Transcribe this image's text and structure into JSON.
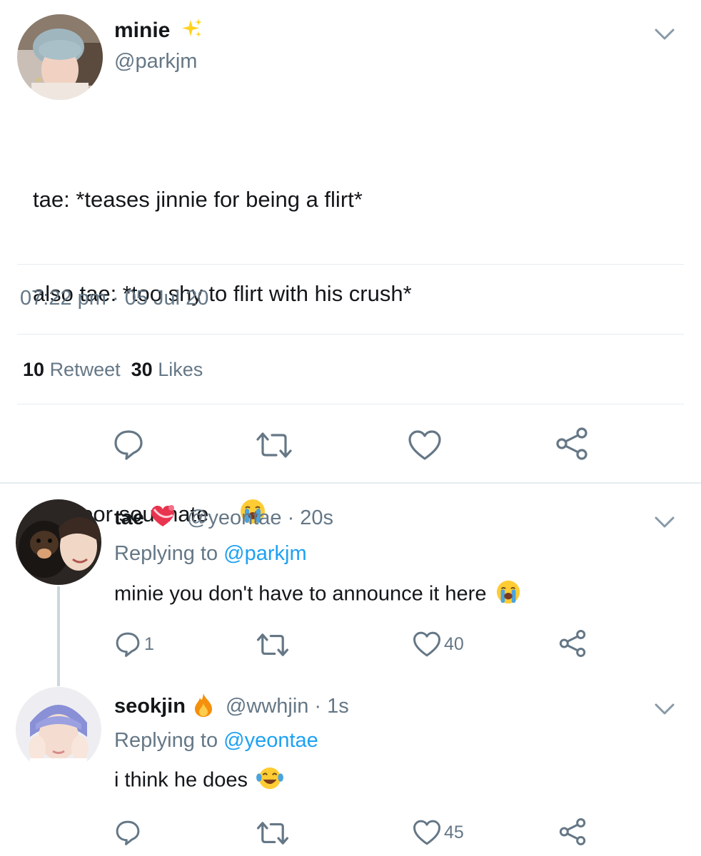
{
  "main_tweet": {
    "name": "minie",
    "handle": "@parkjm",
    "badge_icon": "sparkles-emoji",
    "text_lines": [
      "tae: *teases jinnie for being a flirt*",
      "also tae: *too shy to flirt with his crush*"
    ],
    "text_final": "my poor soulmate",
    "text_emoji": "loudly-crying-face-emoji",
    "time": "07:22 pm",
    "separator": "·",
    "date": "05 Jul 20",
    "retweet_count": "10",
    "retweet_label": "Retweet",
    "like_count": "30",
    "like_label": "Likes"
  },
  "replies": [
    {
      "name": "tae",
      "badge_icon": "heart-with-ribbon-emoji",
      "handle": "@yeontae",
      "time": "· 20s",
      "replying_label": "Replying to",
      "replying_to": "@parkjm",
      "text": "minie you don't have to announce it here",
      "text_emoji": "loudly-crying-face-emoji",
      "reply_count": "1",
      "like_count": "40"
    },
    {
      "name": "seokjin",
      "badge_icon": "fire-emoji",
      "handle": "@wwhjin",
      "time": "· 1s",
      "replying_label": "Replying to",
      "replying_to": "@yeontae",
      "text": "i think he does",
      "text_emoji": "face-with-tears-of-joy-emoji",
      "like_count": "45"
    }
  ],
  "colors": {
    "text": "#14171a",
    "muted": "#657786",
    "link": "#1da1f2",
    "divider": "#e6ecf0"
  }
}
